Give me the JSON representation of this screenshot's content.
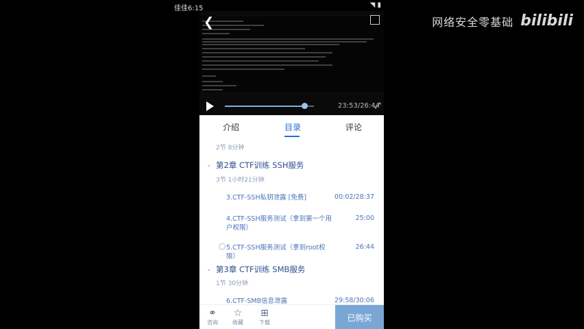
{
  "watermark": {
    "text": "网络安全零基础",
    "logo": "bilibili"
  },
  "statusbar": {
    "left": "佳佳6:15",
    "right": "◥ ▮"
  },
  "video": {
    "back_icon": "chevron-left-icon",
    "timecode": "23:53/26:44",
    "progress": 0.89,
    "expand_glyph": "⤢"
  },
  "tabs": [
    {
      "label": "介绍"
    },
    {
      "label": "目录"
    },
    {
      "label": "评论"
    }
  ],
  "list": {
    "top_sub": "2节 8分钟",
    "chapters": [
      {
        "title": "第2章 CTF训练 SSH服务",
        "sub": "3节 1小时21分钟"
      },
      {
        "title": "第3章 CTF训练 SMB服务",
        "sub": "1节 30分钟"
      }
    ],
    "lessons": [
      {
        "title": "3.CTF-SSH私钥泄露 [免费]",
        "duration": "00:02/28:37"
      },
      {
        "title": "4.CTF-SSH服务测试（拿到第一个用户权限）",
        "duration": "25:00"
      },
      {
        "title": "5.CTF-SSH服务测试（拿到root权限）",
        "duration": "26:44"
      },
      {
        "title": "6.CTF-SMB信息泄露",
        "duration": "29:58/30:06"
      }
    ]
  },
  "bottom": {
    "items": [
      {
        "label": "咨询",
        "icon": "chat-icon"
      },
      {
        "label": "收藏",
        "icon": "star-icon"
      },
      {
        "label": "下载",
        "icon": "download-icon"
      }
    ],
    "buy_label": "已购买"
  }
}
